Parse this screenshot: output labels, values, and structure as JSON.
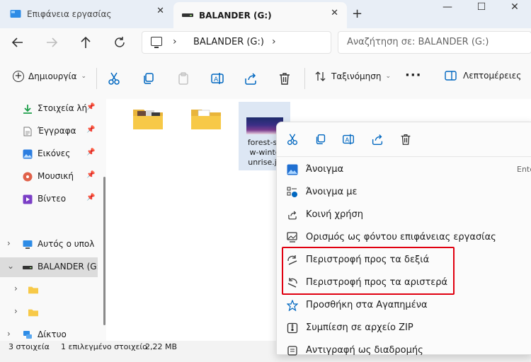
{
  "tabs": [
    {
      "title": "Επιφάνεια εργασίας",
      "close": "✕"
    },
    {
      "title": "BALANDER (G:)",
      "close": "✕"
    }
  ],
  "window_controls": {
    "new_tab": "+",
    "minimize": "—",
    "maximize": "☐",
    "close": "✕"
  },
  "address": {
    "chevron1": "›",
    "location": "BALANDER (G:)",
    "chevron2": "›"
  },
  "search": {
    "placeholder": "Αναζήτηση σε: BALANDER (G:)"
  },
  "toolbar": {
    "new_label": "Δημιουργία",
    "new_caret": "⌄",
    "sort_label": "Ταξινόμηση",
    "sort_caret": "⌄",
    "more": "···",
    "details_label": "Λεπτομέρειες"
  },
  "sidebar": {
    "quick": [
      {
        "label": "Στοιχεία λήψ"
      },
      {
        "label": "Έγγραφα"
      },
      {
        "label": "Εικόνες"
      },
      {
        "label": "Μουσική"
      },
      {
        "label": "Βίντεο"
      }
    ],
    "pin": "📌",
    "this_pc": "Αυτός ο υπολογ",
    "drive": "BALANDER (G:)",
    "network": "Δίκτυο",
    "expand": "›",
    "expanded": "⌄"
  },
  "file": {
    "name_lines": [
      "forest-sn",
      "w-winte",
      "unrise.jp"
    ]
  },
  "status": {
    "count": "3 στοιχεία",
    "selected": "1 επιλεγμένο στοιχείο",
    "size": "2,22 MB"
  },
  "context_menu": {
    "items": [
      {
        "label": "Άνοιγμα",
        "accel": "Ente"
      },
      {
        "label": "Άνοιγμα με"
      },
      {
        "label": "Κοινή χρήση"
      },
      {
        "label": "Ορισμός ως φόντου επιφάνειας εργασίας"
      },
      {
        "label": "Περιστροφή προς τα δεξιά"
      },
      {
        "label": "Περιστροφή προς τα αριστερά"
      },
      {
        "label": "Προσθήκη στα Αγαπημένα"
      },
      {
        "label": "Συμπίεση σε αρχείο ZIP"
      },
      {
        "label": "Αντιγραφή ως διαδρομής"
      }
    ]
  },
  "colors": {
    "accent": "#0067c0",
    "highlight": "#e00010",
    "selection": "#dde7f4"
  }
}
